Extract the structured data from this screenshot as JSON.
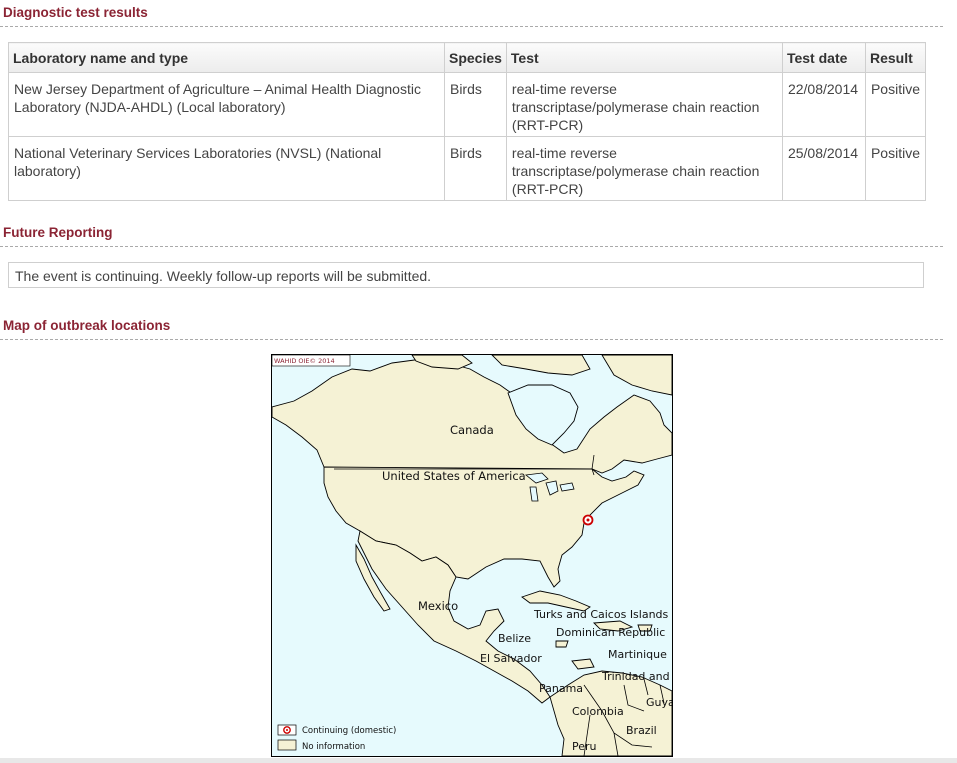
{
  "diagnostic": {
    "title": "Diagnostic test results",
    "headers": [
      "Laboratory name and type",
      "Species",
      "Test",
      "Test date",
      "Result"
    ],
    "rows": [
      {
        "lab": "New Jersey Department of Agriculture – Animal Health Diagnostic Laboratory (NJDA-AHDL) (Local laboratory)",
        "species": "Birds",
        "test": "real-time reverse transcriptase/polymerase chain reaction (RRT-PCR)",
        "date": "22/08/2014",
        "result": "Positive"
      },
      {
        "lab": "National Veterinary Services Laboratories (NVSL) (National laboratory)",
        "species": "Birds",
        "test": "real-time reverse transcriptase/polymerase chain reaction (RRT-PCR)",
        "date": "25/08/2014",
        "result": "Positive"
      }
    ]
  },
  "future": {
    "title": "Future Reporting",
    "text": "The event is continuing. Weekly follow-up reports will be submitted."
  },
  "map": {
    "title": "Map of outbreak locations",
    "copyright": "WAHID OIE© 2014",
    "labels": {
      "canada": "Canada",
      "usa": "United States of America",
      "mexico": "Mexico",
      "turks": "Turks and Caicos Islands",
      "dominican": "Dominican Republic",
      "belize": "Belize",
      "elsalvador": "El Salvador",
      "martinique": "Martinique",
      "trinidad": "Trinidad and Tobago",
      "panama": "Panama",
      "guyana": "Guyana",
      "colombia": "Colombia",
      "brazil": "Brazil",
      "peru": "Peru"
    },
    "legend": {
      "continuing": "Continuing (domestic)",
      "noinfo": "No information"
    },
    "colors": {
      "land": "#f5f2d5",
      "sea": "#e6fafd",
      "marker": "#cc0000"
    }
  }
}
